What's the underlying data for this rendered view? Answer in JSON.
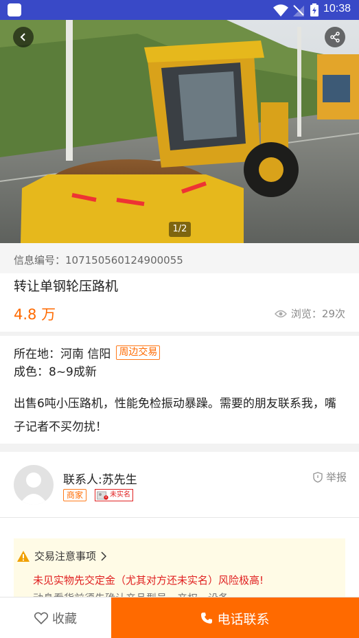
{
  "status_bar": {
    "time": "10:38"
  },
  "gallery": {
    "pager": "1/2"
  },
  "listing": {
    "info_id": "信息编号：107150560124900055",
    "title": "转让单钢轮压路机",
    "price": "4.8 万",
    "views": "浏览：29次"
  },
  "details": {
    "location": "所在地：河南 信阳",
    "nearby_tag": "周边交易",
    "condition": "成色：8~9成新",
    "description": "出售6吨小压路机，性能免检振动暴躁。需要的朋友联系我，嘴子记者不买勿扰！"
  },
  "contact": {
    "name": "联系人:苏先生",
    "merchant_badge": "商家",
    "unverified_badge": "未实名",
    "report": "举报"
  },
  "notice": {
    "title": "交易注意事项",
    "warning": "未见实物先交定金（尤其对方还未实名）风险极高!",
    "sub": "动身看货前须先确认产品型号、产权、设备"
  },
  "bottom_bar": {
    "favorite": "收藏",
    "call": "电话联系"
  },
  "colors": {
    "status_bar": "#3949c7",
    "accent": "#ff6a00",
    "warning": "#e02020"
  }
}
